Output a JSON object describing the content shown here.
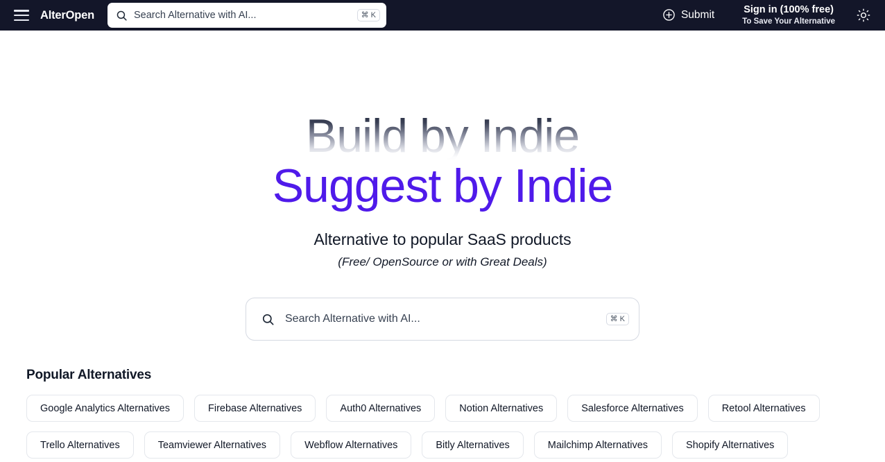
{
  "header": {
    "menu_icon": "hamburger-menu-icon",
    "brand": "AlterOpen",
    "search": {
      "icon": "search-icon",
      "placeholder": "Search Alternative with AI...",
      "value": "",
      "shortcut": "⌘ K"
    },
    "submit": {
      "icon": "plus-circle-icon",
      "label": "Submit"
    },
    "signin": {
      "title": "Sign in (100% free)",
      "subtitle": "To Save Your Alternative"
    },
    "theme_toggle": {
      "icon": "sun-icon"
    },
    "colors": {
      "background": "#131629",
      "text": "#ffffff"
    }
  },
  "hero": {
    "line1": "Build by Indie",
    "line2": "Suggest by Indie",
    "subtitle": "Alternative to popular SaaS products",
    "subtitle2": "(Free/ OpenSource or with Great Deals)",
    "accent_color": "#4f1aea",
    "search": {
      "icon": "search-icon",
      "placeholder": "Search Alternative with AI...",
      "value": "",
      "shortcut": "⌘ K"
    }
  },
  "popular": {
    "title": "Popular Alternatives",
    "rows": [
      [
        {
          "label": "Google Analytics Alternatives"
        },
        {
          "label": "Firebase Alternatives"
        },
        {
          "label": "Auth0 Alternatives"
        },
        {
          "label": "Notion Alternatives"
        },
        {
          "label": "Salesforce Alternatives"
        },
        {
          "label": "Retool Alternatives"
        }
      ],
      [
        {
          "label": "Trello Alternatives"
        },
        {
          "label": "Teamviewer Alternatives"
        },
        {
          "label": "Webflow Alternatives"
        },
        {
          "label": "Bitly Alternatives"
        },
        {
          "label": "Mailchimp Alternatives"
        },
        {
          "label": "Shopify Alternatives"
        }
      ]
    ]
  }
}
